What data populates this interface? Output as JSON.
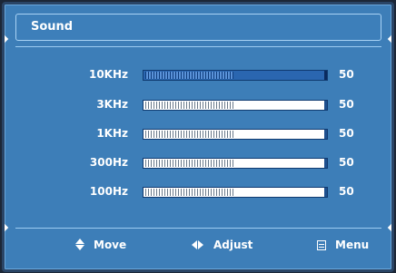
{
  "header": {
    "title": "Sound"
  },
  "equalizer": {
    "bands": [
      {
        "label": "10KHz",
        "value": "50",
        "selected": true
      },
      {
        "label": "3KHz",
        "value": "50",
        "selected": false
      },
      {
        "label": "1KHz",
        "value": "50",
        "selected": false
      },
      {
        "label": "300Hz",
        "value": "50",
        "selected": false
      },
      {
        "label": "100Hz",
        "value": "50",
        "selected": false
      }
    ],
    "max_value": 100
  },
  "footer": {
    "move_label": "Move",
    "move_icon": "up-down-arrows-icon",
    "adjust_label": "Adjust",
    "adjust_icon": "left-right-arrows-icon",
    "menu_label": "Menu",
    "menu_icon": "menu-icon"
  },
  "colors": {
    "panel_bg": "#3d7eb8",
    "selected_slider": "#2a66b0",
    "text": "#ffffff"
  }
}
